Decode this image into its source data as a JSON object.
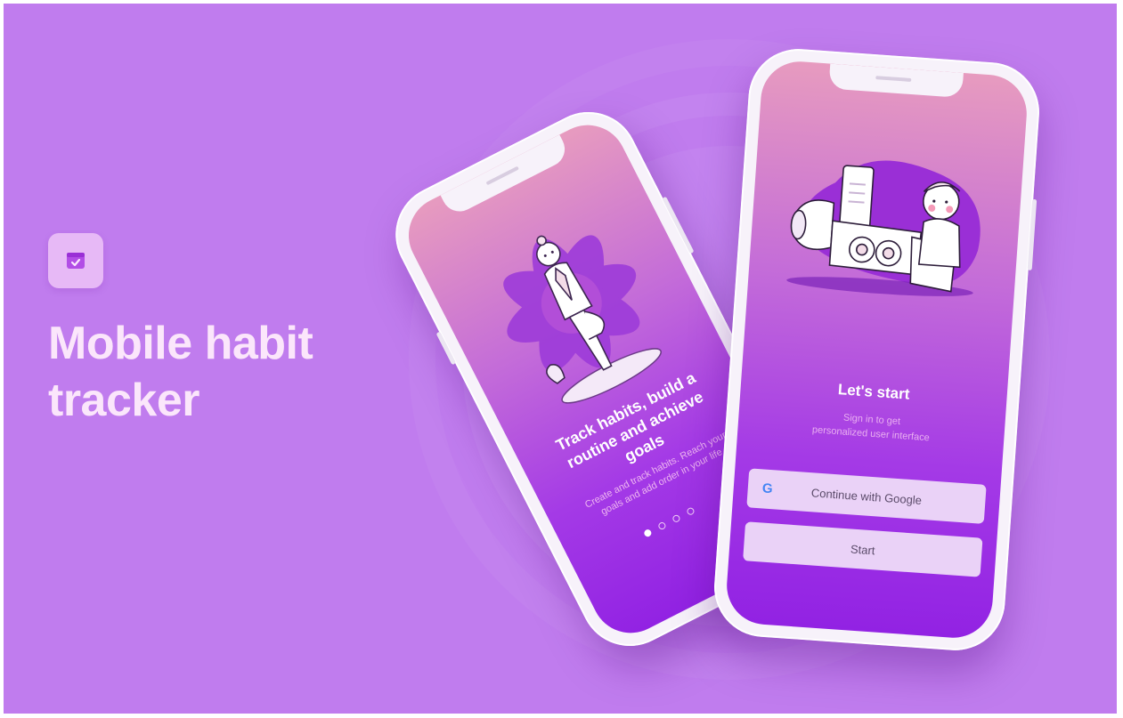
{
  "headline": {
    "line1": "Mobile habit",
    "line2": "tracker"
  },
  "onboarding": {
    "title": "Track habits, build a routine and achieve goals",
    "description": "Create and track habits. Reach your goals and add order in your life",
    "pages_total": 4,
    "current_page": 1
  },
  "signin": {
    "title": "Let's start",
    "subtitle_line1": "Sign in to get",
    "subtitle_line2": "personalized user interface",
    "google_button": "Continue with Google",
    "start_button": "Start"
  },
  "colors": {
    "background": "#c07cee",
    "screen_gradient_top": "#e79bbf",
    "screen_gradient_bottom": "#9222e3",
    "button_bg": "#ead2f7",
    "headline": "#fbe6fb"
  },
  "icons": {
    "app": "calendar-check-icon",
    "google": "google-g-icon"
  }
}
